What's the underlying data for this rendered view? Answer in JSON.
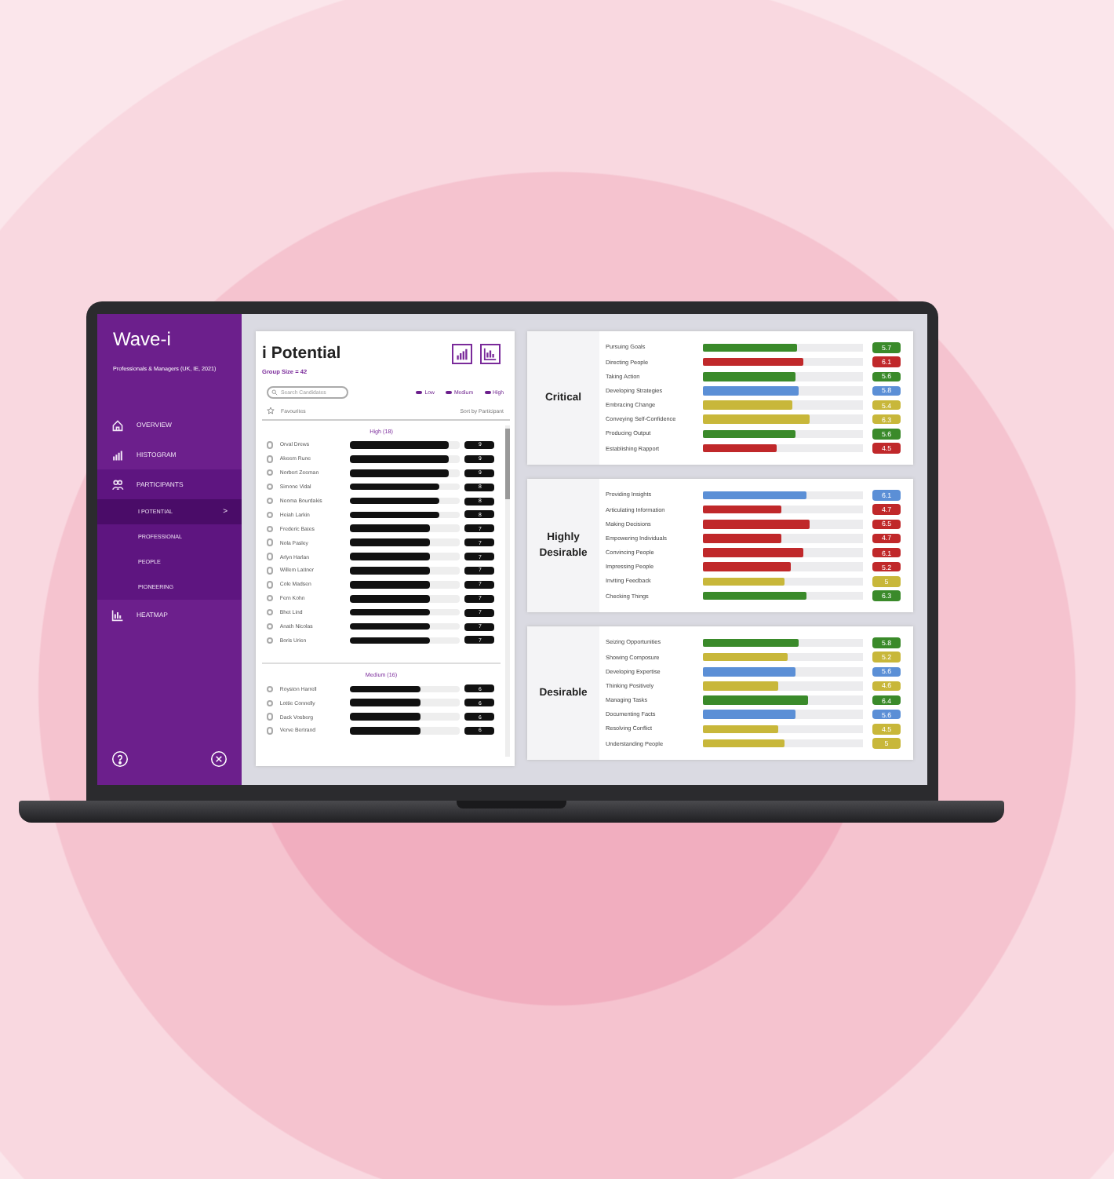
{
  "sidebar": {
    "title": "Wave-i",
    "subtitle": "Professionals & Managers (UK, IE, 2021)",
    "nav": [
      {
        "label": "OVERVIEW",
        "expanded": false
      },
      {
        "label": "HISTOGRAM",
        "expanded": false
      },
      {
        "label": "PARTICIPANTS",
        "expanded": true,
        "children": [
          {
            "label": "I POTENTIAL",
            "selected": true,
            "arrow": ">"
          },
          {
            "label": "PROFESSIONAL",
            "selected": false
          },
          {
            "label": "PEOPLE",
            "selected": false
          },
          {
            "label": "PIONEERING",
            "selected": false
          }
        ]
      },
      {
        "label": "HEATMAP",
        "expanded": false
      }
    ]
  },
  "panel": {
    "title": "i Potential",
    "group_size": "Group Size = 42",
    "search": {
      "placeholder": "Search Candidates"
    },
    "filters": [
      {
        "label": "Low",
        "on": true
      },
      {
        "label": "Medium",
        "on": true
      },
      {
        "label": "High",
        "on": true
      }
    ],
    "favourites": "Favourites",
    "sort": "Sort by Participant",
    "groups": [
      {
        "heading": "High (18)",
        "participants": [
          {
            "name": "Orval Drews",
            "level": 0.9,
            "score": "9"
          },
          {
            "name": "Akeem Rune",
            "level": 0.9,
            "score": "9"
          },
          {
            "name": "Norbert Zeeman",
            "level": 0.9,
            "score": "9"
          },
          {
            "name": "Simone Vidal",
            "level": 0.81,
            "score": "8"
          },
          {
            "name": "Neoma Bourdakis",
            "level": 0.81,
            "score": "8"
          },
          {
            "name": "Heiah Larkin",
            "level": 0.81,
            "score": "8"
          },
          {
            "name": "Frederic Bates",
            "level": 0.73,
            "score": "7"
          },
          {
            "name": "Nola Pasley",
            "level": 0.73,
            "score": "7"
          },
          {
            "name": "Arlyn Harlan",
            "level": 0.73,
            "score": "7"
          },
          {
            "name": "Willem Lattner",
            "level": 0.73,
            "score": "7"
          },
          {
            "name": "Cole Madsen",
            "level": 0.73,
            "score": "7"
          },
          {
            "name": "Fern Kohn",
            "level": 0.73,
            "score": "7"
          },
          {
            "name": "Bhet Lind",
            "level": 0.73,
            "score": "7"
          },
          {
            "name": "Anath Nicolas",
            "level": 0.73,
            "score": "7"
          },
          {
            "name": "Boris Urien",
            "level": 0.73,
            "score": "7"
          }
        ]
      },
      {
        "heading": "Medium (16)",
        "participants": [
          {
            "name": "Royston Harrell",
            "level": 0.64,
            "score": "6"
          },
          {
            "name": "Lottie Connelly",
            "level": 0.64,
            "score": "6"
          },
          {
            "name": "Dack Vosberg",
            "level": 0.64,
            "score": "6"
          },
          {
            "name": "Verve Bertrand",
            "level": 0.64,
            "score": "6"
          }
        ]
      }
    ]
  },
  "sections": [
    {
      "title": "Critical",
      "rows": [
        {
          "label": "Pursuing Goals",
          "level": 0.59,
          "score": "5.7",
          "color": "#3a8a2a"
        },
        {
          "label": "Directing People",
          "level": 0.63,
          "score": "6.1",
          "color": "#c0282a"
        },
        {
          "label": "Taking Action",
          "level": 0.58,
          "score": "5.6",
          "color": "#3a8a2a"
        },
        {
          "label": "Developing Strategies",
          "level": 0.6,
          "score": "5.8",
          "color": "#5b8fd6"
        },
        {
          "label": "Embracing Change",
          "level": 0.56,
          "score": "5.4",
          "color": "#c8b73a"
        },
        {
          "label": "Conveying Self-Confidence",
          "level": 0.67,
          "score": "6.3",
          "color": "#c8b73a"
        },
        {
          "label": "Producing Output",
          "level": 0.58,
          "score": "5.6",
          "color": "#3a8a2a"
        },
        {
          "label": "Establishing Rapport",
          "level": 0.46,
          "score": "4.5",
          "color": "#c0282a"
        }
      ]
    },
    {
      "title": "Highly Desirable",
      "rows": [
        {
          "label": "Providing Insights",
          "level": 0.65,
          "score": "6.1",
          "color": "#5b8fd6"
        },
        {
          "label": "Articulating Information",
          "level": 0.49,
          "score": "4.7",
          "color": "#c0282a"
        },
        {
          "label": "Making Decisions",
          "level": 0.67,
          "score": "6.5",
          "color": "#c0282a"
        },
        {
          "label": "Empowering Individuals",
          "level": 0.49,
          "score": "4.7",
          "color": "#c0282a"
        },
        {
          "label": "Convincing People",
          "level": 0.63,
          "score": "6.1",
          "color": "#c0282a"
        },
        {
          "label": "Impressing People",
          "level": 0.55,
          "score": "5.2",
          "color": "#c0282a"
        },
        {
          "label": "Inviting Feedback",
          "level": 0.51,
          "score": "5",
          "color": "#c8b73a"
        },
        {
          "label": "Checking Things",
          "level": 0.65,
          "score": "6.3",
          "color": "#3a8a2a"
        }
      ]
    },
    {
      "title": "Desirable",
      "rows": [
        {
          "label": "Seizing Opportunities",
          "level": 0.6,
          "score": "5.8",
          "color": "#3a8a2a"
        },
        {
          "label": "Showing Composure",
          "level": 0.53,
          "score": "5.2",
          "color": "#c8b73a"
        },
        {
          "label": "Developing Expertise",
          "level": 0.58,
          "score": "5.6",
          "color": "#5b8fd6"
        },
        {
          "label": "Thinking Positively",
          "level": 0.47,
          "score": "4.6",
          "color": "#c8b73a"
        },
        {
          "label": "Managing Tasks",
          "level": 0.66,
          "score": "6.4",
          "color": "#3a8a2a"
        },
        {
          "label": "Documenting Facts",
          "level": 0.58,
          "score": "5.6",
          "color": "#5b8fd6"
        },
        {
          "label": "Resolving Conflict",
          "level": 0.47,
          "score": "4.5",
          "color": "#c8b73a"
        },
        {
          "label": "Understanding People",
          "level": 0.51,
          "score": "5",
          "color": "#c8b73a"
        }
      ]
    }
  ]
}
